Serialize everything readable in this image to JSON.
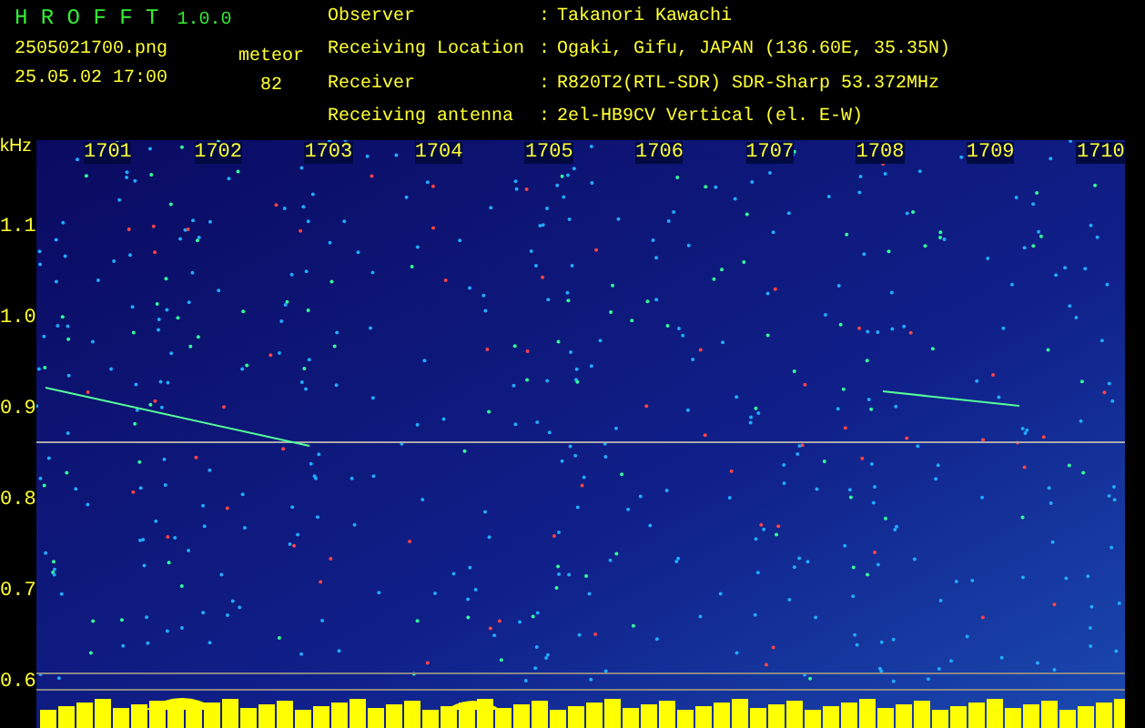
{
  "app": {
    "title": "H R O F F T",
    "version": "1.0.0",
    "filename": "2505021700.png",
    "datetime": "25.05.02 17:00"
  },
  "meteor": {
    "label": "meteor",
    "count": "82"
  },
  "info": [
    {
      "label": "Observer",
      "separator": ":",
      "value": "Takanori Kawachi"
    },
    {
      "label": "Receiving Location",
      "separator": ":",
      "value": "Ogaki, Gifu, JAPAN (136.60E, 35.35N)"
    },
    {
      "label": "Receiver",
      "separator": ":",
      "value": "R820T2(RTL-SDR) SDR-Sharp 53.372MHz"
    },
    {
      "label": "Receiving antenna",
      "separator": ":",
      "value": "2el-HB9CV Vertical (el. E-W)"
    }
  ],
  "spectrogram": {
    "y_unit": "kHz",
    "y_labels": [
      "1.1",
      "1.0",
      "0.9",
      "0.8",
      "0.7",
      "0.6"
    ],
    "minute_labels": [
      "1701",
      "1702",
      "1703",
      "1704",
      "1705",
      "1706",
      "1707",
      "1708",
      "1709",
      "1710"
    ]
  }
}
